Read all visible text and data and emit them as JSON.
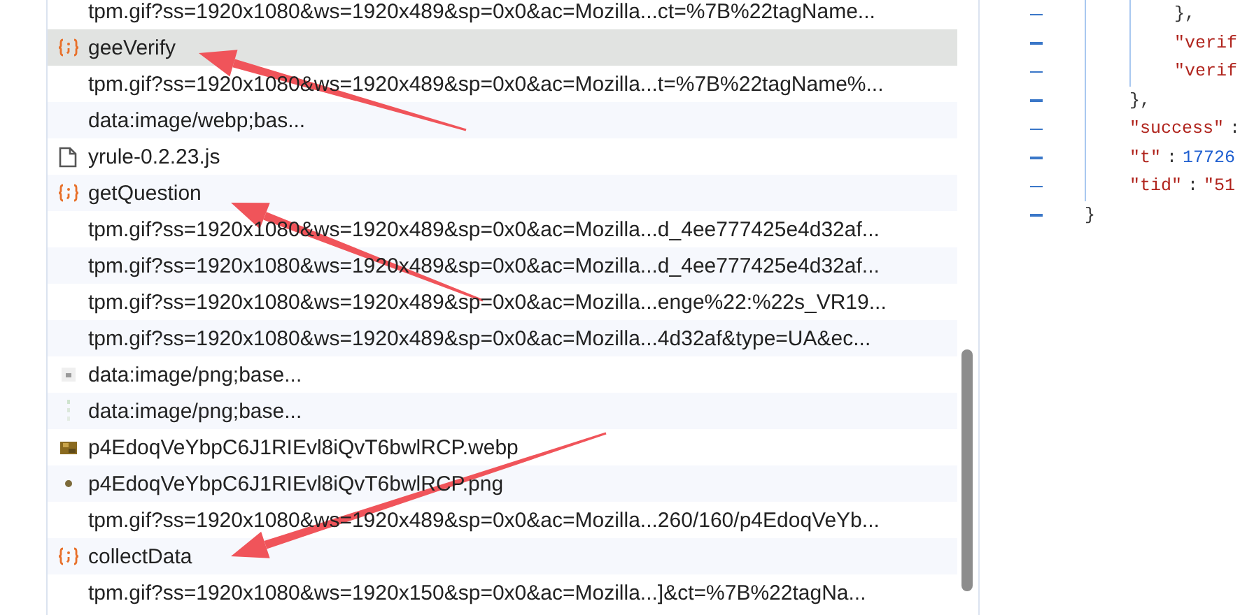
{
  "requests": [
    {
      "kind": "request",
      "name": "tpm.gif?ss=1920x1080&ws=1920x489&sp=0x0&ac=Mozilla...ct=%7B%22tagName...",
      "selected": false
    },
    {
      "kind": "fetch",
      "name": "geeVerify",
      "selected": true
    },
    {
      "kind": "request",
      "name": "tpm.gif?ss=1920x1080&ws=1920x489&sp=0x0&ac=Mozilla...t=%7B%22tagName%...",
      "selected": false
    },
    {
      "kind": "request",
      "name": "data:image/webp;bas...",
      "selected": false
    },
    {
      "kind": "script",
      "name": "yrule-0.2.23.js",
      "selected": false
    },
    {
      "kind": "fetch",
      "name": "getQuestion",
      "selected": false
    },
    {
      "kind": "request",
      "name": "tpm.gif?ss=1920x1080&ws=1920x489&sp=0x0&ac=Mozilla...d_4ee777425e4d32af...",
      "selected": false
    },
    {
      "kind": "request",
      "name": "tpm.gif?ss=1920x1080&ws=1920x489&sp=0x0&ac=Mozilla...d_4ee777425e4d32af...",
      "selected": false
    },
    {
      "kind": "request",
      "name": "tpm.gif?ss=1920x1080&ws=1920x489&sp=0x0&ac=Mozilla...enge%22:%22s_VR19...",
      "selected": false
    },
    {
      "kind": "request",
      "name": "tpm.gif?ss=1920x1080&ws=1920x489&sp=0x0&ac=Mozilla...4d32af&type=UA&ec...",
      "selected": false
    },
    {
      "kind": "image",
      "name": "data:image/png;base...",
      "selected": false
    },
    {
      "kind": "image",
      "name": "data:image/png;base...",
      "selected": false
    },
    {
      "kind": "image",
      "name": "p4EdoqVeYbpC6J1RIEvl8iQvT6bwlRCP.webp",
      "selected": false
    },
    {
      "kind": "image",
      "name": "p4EdoqVeYbpC6J1RIEvl8iQvT6bwlRCP.png",
      "selected": false
    },
    {
      "kind": "request",
      "name": "tpm.gif?ss=1920x1080&ws=1920x489&sp=0x0&ac=Mozilla...260/160/p4EdoqVeYb...",
      "selected": false
    },
    {
      "kind": "fetch",
      "name": "collectData",
      "selected": false
    },
    {
      "kind": "request",
      "name": "tpm.gif?ss=1920x1080&ws=1920x150&sp=0x0&ac=Mozilla...]&ct=%7B%22tagNa...",
      "selected": false
    }
  ],
  "response": {
    "children": [
      {
        "children": [
          {
            "close": "},"
          },
          {
            "tokens": [
              {
                "kind": "key",
                "text": "\"verif"
              }
            ]
          },
          {
            "tokens": [
              {
                "kind": "key",
                "text": "\"verif"
              }
            ]
          }
        ],
        "close": "},"
      },
      {
        "tokens": [
          {
            "kind": "key",
            "text": "\"success\""
          },
          {
            "kind": "punct",
            "text": ":"
          }
        ]
      },
      {
        "tokens": [
          {
            "kind": "key",
            "text": "\"t\""
          },
          {
            "kind": "punct",
            "text": ":"
          },
          {
            "kind": "number",
            "text": "17726"
          }
        ]
      },
      {
        "tokens": [
          {
            "kind": "key",
            "text": "\"tid\""
          },
          {
            "kind": "punct",
            "text": ":"
          },
          {
            "kind": "key",
            "text": "\"51"
          }
        ]
      }
    ],
    "close": "}"
  }
}
